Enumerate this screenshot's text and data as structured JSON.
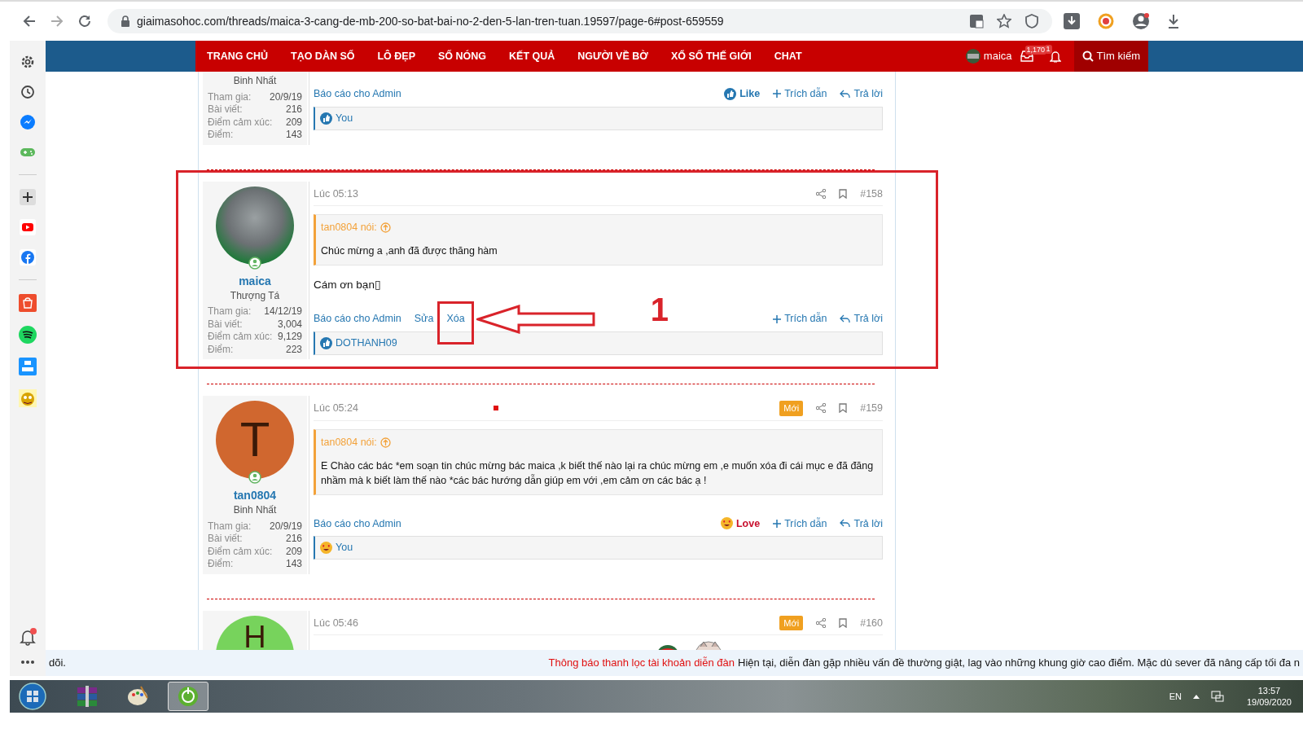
{
  "browser": {
    "url": "giaimasohoc.com/threads/maica-3-cang-de-mb-200-so-bat-bai-no-2-den-5-lan-tren-tuan.19597/page-6#post-659559"
  },
  "nav": {
    "items": [
      "TRANG CHỦ",
      "TẠO DÀN SỐ",
      "LÔ ĐẸP",
      "SỐ NÓNG",
      "KẾT QUẢ",
      "NGƯỜI VỀ BỜ",
      "XỔ SỐ THẾ GIỚI",
      "CHAT"
    ],
    "user": "maica",
    "inbox_count": "1,170",
    "alert_count": "1",
    "search": "Tìm kiếm"
  },
  "posts": [
    {
      "rank": "Binh Nhất",
      "stats": [
        {
          "label": "Tham gia:",
          "value": "20/9/19"
        },
        {
          "label": "Bài viết:",
          "value": "216"
        },
        {
          "label": "Điểm cảm xúc:",
          "value": "209"
        },
        {
          "label": "Điểm:",
          "value": "143"
        }
      ],
      "actions": [
        {
          "kind": "report",
          "label": "Báo cáo cho Admin"
        },
        {
          "kind": "like",
          "label": "Like"
        },
        {
          "kind": "quote",
          "label": "Trích dẫn"
        },
        {
          "kind": "reply",
          "label": "Trả lời"
        }
      ],
      "reactions": {
        "kind": "like",
        "users": "You"
      }
    },
    {
      "highlighted": true,
      "avatar": {
        "kind": "photo",
        "online": true
      },
      "author": "maica",
      "rank": "Thượng Tá",
      "stats": [
        {
          "label": "Tham gia:",
          "value": "14/12/19"
        },
        {
          "label": "Bài viết:",
          "value": "3,004"
        },
        {
          "label": "Điểm cảm xúc:",
          "value": "9,129"
        },
        {
          "label": "Điểm:",
          "value": "223"
        }
      ],
      "time": "Lúc 05:13",
      "number": "#158",
      "quote": {
        "author": "tan0804 nói:",
        "text": "Chúc mừng a ,anh đã được thăng hàm"
      },
      "body": "Cám ơn bạn▯",
      "actions": [
        {
          "kind": "report",
          "label": "Báo cáo cho Admin"
        },
        {
          "kind": "edit",
          "label": "Sửa"
        },
        {
          "kind": "delete",
          "label": "Xóa",
          "highlighted": true
        },
        {
          "kind": "quote",
          "label": "Trích dẫn"
        },
        {
          "kind": "reply",
          "label": "Trả lời"
        }
      ],
      "reactions": {
        "kind": "like",
        "users": "DOTHANH09"
      }
    },
    {
      "avatar": {
        "kind": "letter",
        "letter": "T",
        "color": "#d0672f",
        "online": true
      },
      "author": "tan0804",
      "rank": "Binh Nhất",
      "stats": [
        {
          "label": "Tham gia:",
          "value": "20/9/19"
        },
        {
          "label": "Bài viết:",
          "value": "216"
        },
        {
          "label": "Điểm cảm xúc:",
          "value": "209"
        },
        {
          "label": "Điểm:",
          "value": "143"
        }
      ],
      "time": "Lúc 05:24",
      "new": true,
      "new_label": "Mới",
      "number": "#159",
      "quote": {
        "author": "tan0804 nói:",
        "text": "E Chào các bác *em soạn tin chúc mừng bác maica ,k biết thế nào lại ra chúc mừng em ,e muốn xóa đi cái mục e đã đăng nhầm mà k biết làm thế nào *các bác hướng dẫn giúp em với ,em cảm ơn các bác ạ !"
      },
      "actions": [
        {
          "kind": "report",
          "label": "Báo cáo cho Admin"
        },
        {
          "kind": "love",
          "label": "Love"
        },
        {
          "kind": "quote",
          "label": "Trích dẫn"
        },
        {
          "kind": "reply",
          "label": "Trả lời"
        }
      ],
      "reactions": {
        "kind": "love",
        "users": "You"
      }
    },
    {
      "avatar": {
        "kind": "letter",
        "letter": "H",
        "color": "#77d35c"
      },
      "time": "Lúc 05:46",
      "new": true,
      "new_label": "Mới",
      "number": "#160",
      "sticker": true
    }
  ],
  "annotation": {
    "label": "1"
  },
  "ticker": {
    "lead": "dõi.",
    "title": "Thông báo thanh lọc tài khoản diễn đàn",
    "text": "Hiện tại, diễn đàn gặp nhiều vấn đề thường giật, lag vào những khung giờ cao điểm. Mặc dù sever đã nâng cấp tối đa n"
  },
  "taskbar": {
    "language": "EN",
    "time": "13:57",
    "date": "19/09/2020"
  }
}
